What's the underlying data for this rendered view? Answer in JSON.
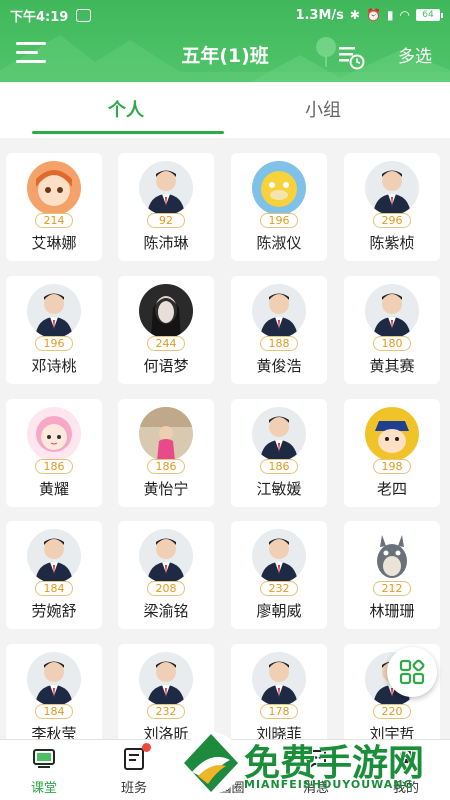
{
  "status_bar": {
    "time": "下午4:19",
    "net_speed": "1.3M/s",
    "battery": "64"
  },
  "header": {
    "title": "五年(1)班",
    "multi_select": "多选",
    "menu_icon": "hamburger-menu-icon",
    "schedule_icon": "list-clock-icon"
  },
  "tabs": {
    "personal": "个人",
    "group": "小组",
    "active": "personal"
  },
  "students": [
    {
      "name": "艾琳娜",
      "score": "214",
      "avatar": "anime-girl"
    },
    {
      "name": "陈沛琳",
      "score": "92",
      "avatar": "uniform"
    },
    {
      "name": "陈淑仪",
      "score": "196",
      "avatar": "psyduck"
    },
    {
      "name": "陈紫桢",
      "score": "296",
      "avatar": "uniform"
    },
    {
      "name": "邓诗桃",
      "score": "196",
      "avatar": "uniform"
    },
    {
      "name": "何语梦",
      "score": "244",
      "avatar": "dark-portrait"
    },
    {
      "name": "黄俊浩",
      "score": "188",
      "avatar": "uniform"
    },
    {
      "name": "黄其赛",
      "score": "180",
      "avatar": "uniform"
    },
    {
      "name": "黄耀",
      "score": "186",
      "avatar": "cartoon-girl"
    },
    {
      "name": "黄怡宁",
      "score": "186",
      "avatar": "room-photo"
    },
    {
      "name": "江敏媛",
      "score": "186",
      "avatar": "uniform"
    },
    {
      "name": "老四",
      "score": "198",
      "avatar": "crayon-boy"
    },
    {
      "name": "劳婉舒",
      "score": "184",
      "avatar": "uniform"
    },
    {
      "name": "梁渝铭",
      "score": "208",
      "avatar": "uniform"
    },
    {
      "name": "廖朝威",
      "score": "232",
      "avatar": "uniform"
    },
    {
      "name": "林珊珊",
      "score": "212",
      "avatar": "totoro"
    },
    {
      "name": "李秋莹",
      "score": "184",
      "avatar": "uniform"
    },
    {
      "name": "刘洛昕",
      "score": "232",
      "avatar": "uniform"
    },
    {
      "name": "刘晓菲",
      "score": "178",
      "avatar": "uniform"
    },
    {
      "name": "刘宇哲",
      "score": "220",
      "avatar": "uniform"
    }
  ],
  "bottom_nav": [
    {
      "label": "课堂",
      "icon": "classroom-icon",
      "active": true
    },
    {
      "label": "班务",
      "icon": "class-affairs-icon",
      "active": false
    },
    {
      "label": "校园圈",
      "icon": "campus-circle-icon",
      "active": false
    },
    {
      "label": "消息",
      "icon": "message-icon",
      "active": false
    },
    {
      "label": "我的",
      "icon": "profile-icon",
      "active": false
    }
  ],
  "watermark": {
    "text": "免费手游网",
    "subtext": "MIANFEISHOUYOUWANG"
  },
  "colors": {
    "primary_green": "#2fa84a",
    "header_green": "#4cbf63",
    "score_orange": "#e19a1e"
  }
}
